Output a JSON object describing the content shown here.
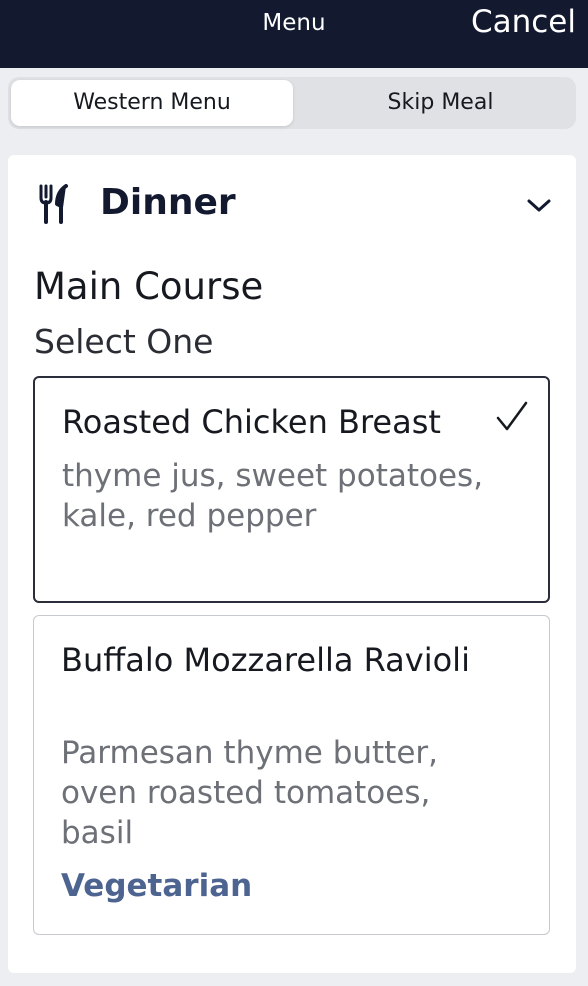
{
  "header": {
    "title": "Menu",
    "cancel_label": "Cancel"
  },
  "tabs": [
    {
      "label": "Western Menu",
      "selected": true
    },
    {
      "label": "Skip Meal",
      "selected": false
    }
  ],
  "meal": {
    "title": "Dinner",
    "icon": "fork-knife-icon",
    "expanded": true,
    "section": {
      "title": "Main Course",
      "subtitle": "Select One",
      "options": [
        {
          "name": "Roasted Chicken Breast",
          "description": "thyme jus, sweet potatoes, kale, red pepper",
          "tag": "",
          "selected": true
        },
        {
          "name": "Buffalo Mozzarella Ravioli",
          "description": "Parmesan thyme butter, oven roasted tomatoes, basil",
          "tag": "Vegetarian",
          "selected": false
        }
      ]
    }
  },
  "colors": {
    "header_bg": "#131a30",
    "tag": "#4d6390",
    "page_bg": "#eceef1"
  }
}
